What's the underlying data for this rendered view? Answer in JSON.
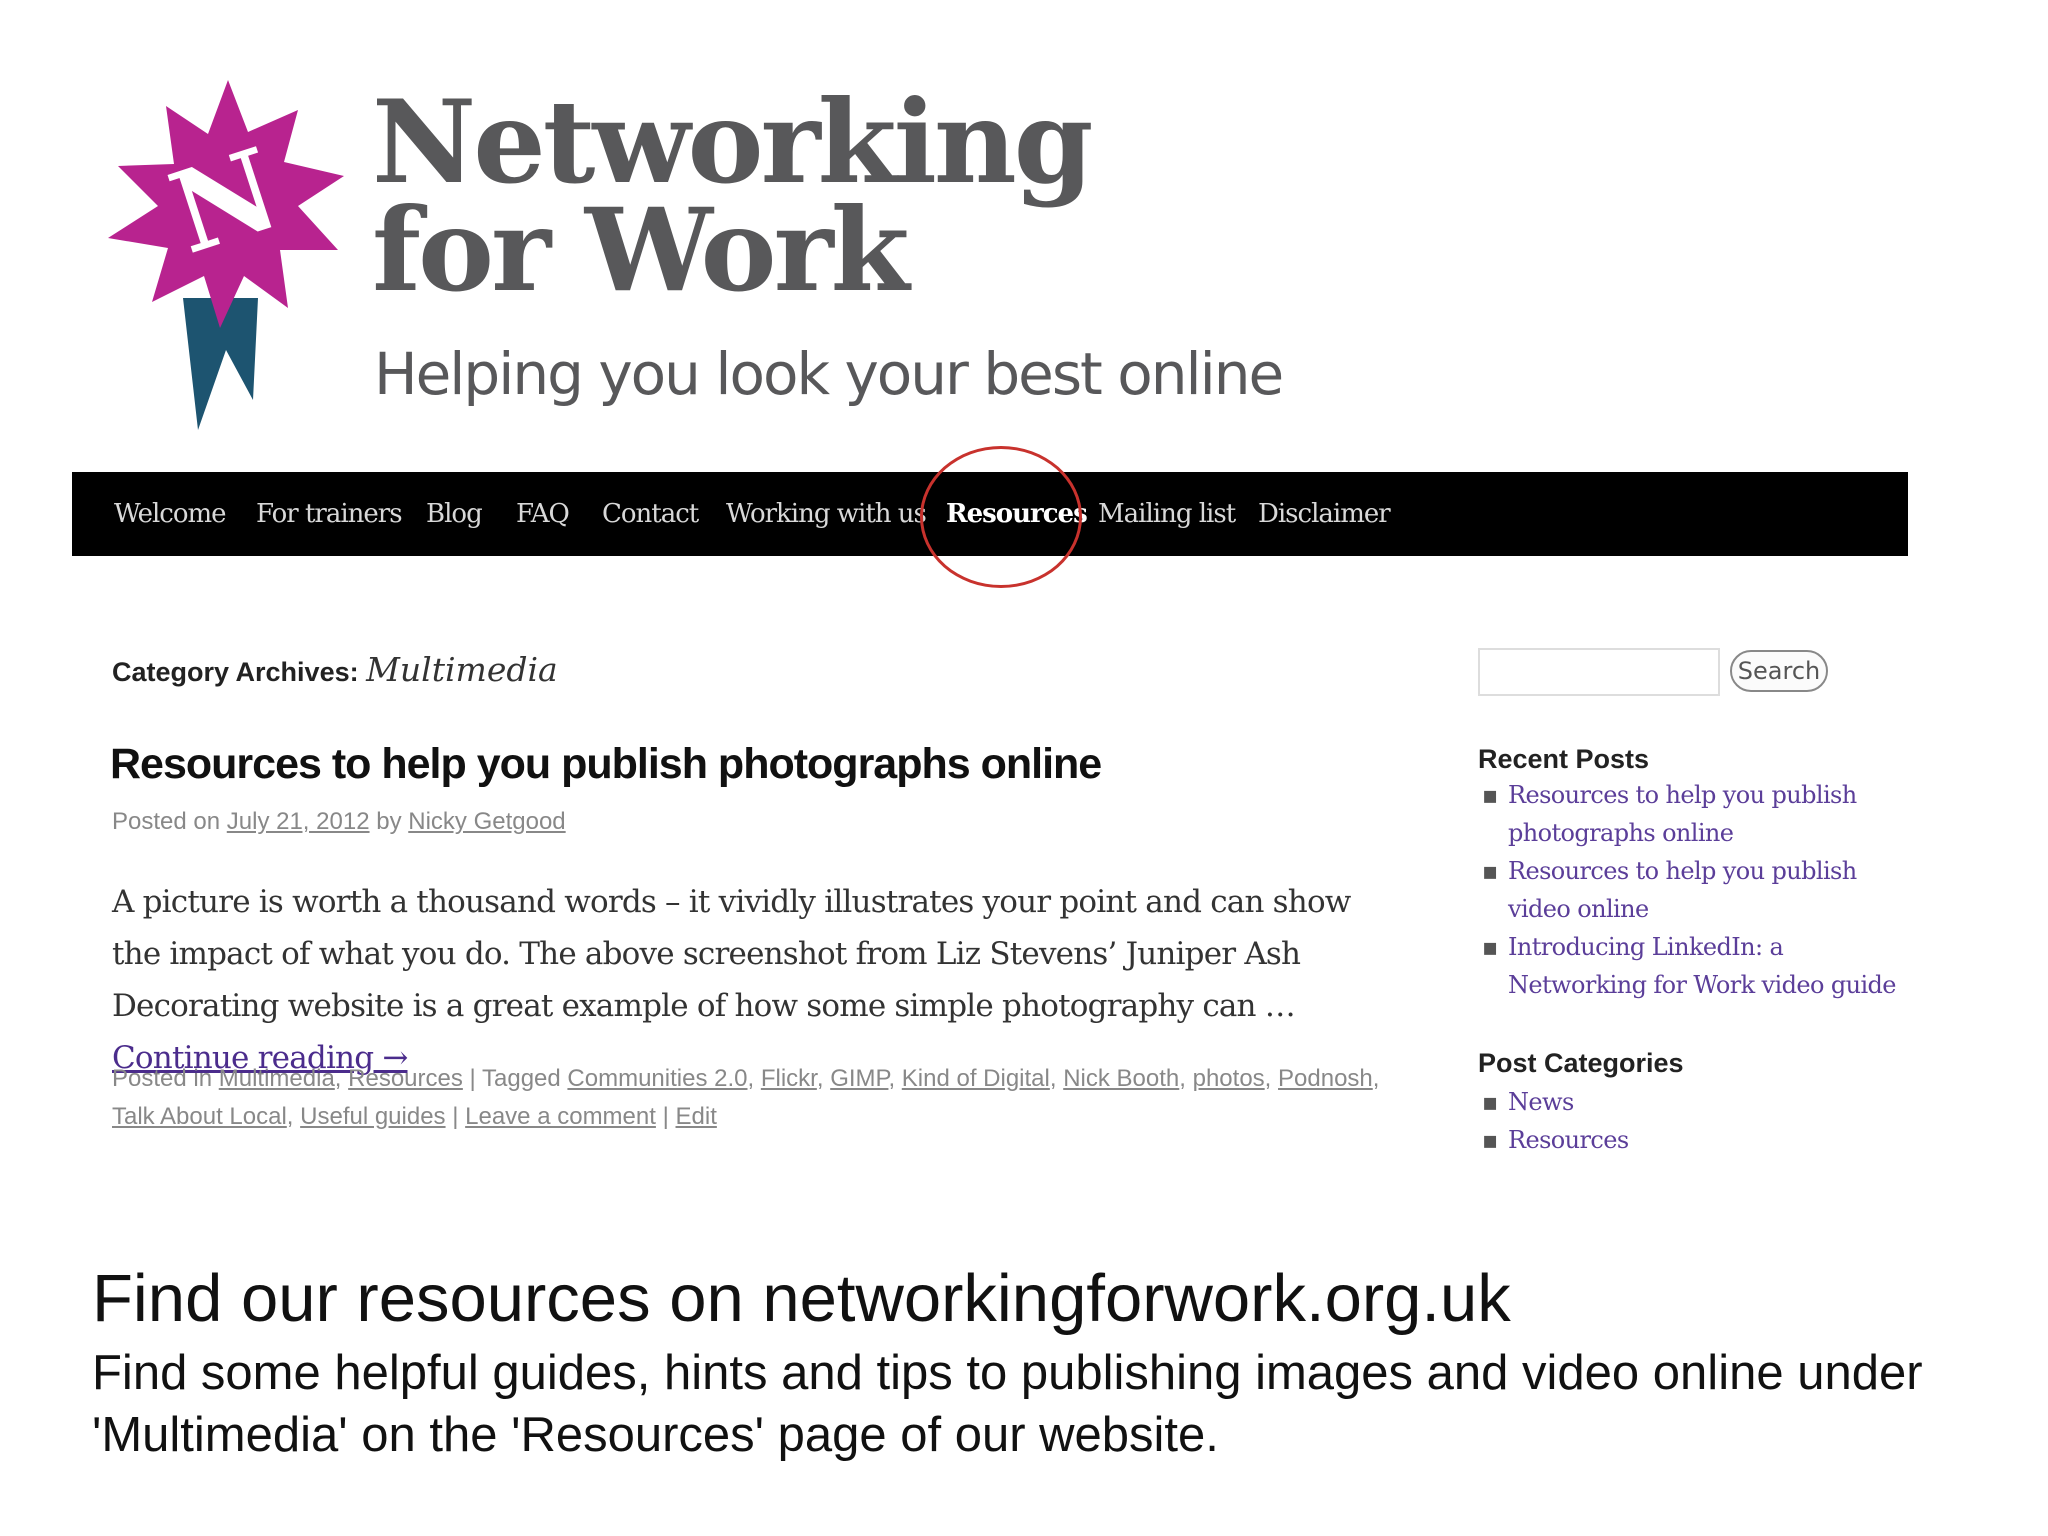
{
  "brand": {
    "title_line1": "Networking",
    "title_line2": "for Work",
    "logo_letter": "N",
    "tagline": "Helping you look your best online"
  },
  "colors": {
    "logo_magenta": "#b8238f",
    "logo_ribbon": "#1d5470",
    "nav_bg": "#000000",
    "highlight_circle": "#c8322d",
    "link": "#4b2c8c"
  },
  "nav": [
    "Welcome",
    "For trainers",
    "Blog",
    "FAQ",
    "Contact",
    "Working with us",
    "Resources",
    "Mailing list",
    "Disclaimer"
  ],
  "nav_active": "Resources",
  "archive": {
    "prefix": "Category Archives:",
    "category": "Multimedia"
  },
  "post": {
    "title": "Resources to help you publish photographs online",
    "posted_on": "Posted on",
    "date": "July 21, 2012",
    "by": "by",
    "author": "Nicky Getgood",
    "excerpt": "A picture is worth a thousand words – it vividly illustrates your point and can show the impact of what you do. The above screenshot from Liz Stevens’ Juniper Ash Decorating website is a great example of how some simple photography can …",
    "continue": "Continue reading →",
    "posted_in": "Posted in",
    "categories": [
      "Multimedia",
      "Resources"
    ],
    "tagged": "Tagged",
    "tags": [
      "Communities 2.0",
      "Flickr",
      "GIMP",
      "Kind of Digital",
      "Nick Booth",
      "photos",
      "Podnosh",
      "Talk About Local",
      "Useful guides"
    ],
    "leave_comment": "Leave a comment",
    "edit": "Edit"
  },
  "sidebar": {
    "search_button": "Search",
    "search_value": "",
    "recent_title": "Recent Posts",
    "recent": [
      "Resources to help you publish photographs online",
      "Resources to help you publish video online",
      "Introducing LinkedIn: a Networking for Work video guide"
    ],
    "categories_title": "Post Categories",
    "categories": [
      "News",
      "Resources"
    ]
  },
  "caption": {
    "title": "Find our resources on networkingforwork.org.uk",
    "body": "Find some helpful guides, hints and tips to publishing images and video online under 'Multimedia' on the 'Resources' page of our website."
  }
}
